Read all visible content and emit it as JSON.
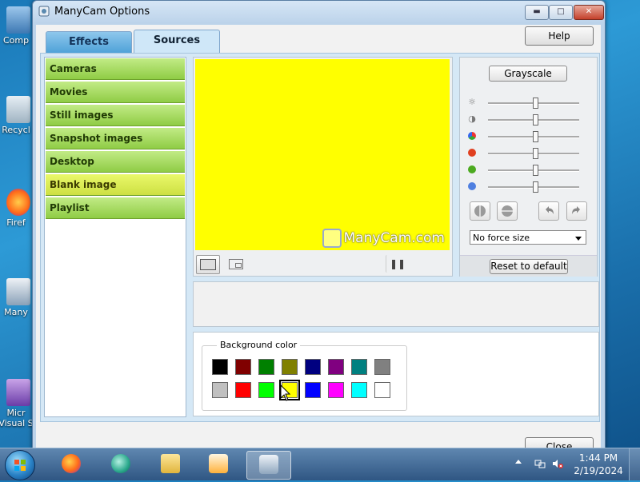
{
  "desktop": {
    "icons": [
      {
        "label": "Comp"
      },
      {
        "label": "Recycl"
      },
      {
        "label": "Firef"
      },
      {
        "label": "Many"
      },
      {
        "label": "Micr",
        "label2": "Visual S"
      }
    ]
  },
  "window": {
    "title": "ManyCam Options",
    "buttons": {
      "minimize": "▬",
      "maximize": "□",
      "close": "✕"
    }
  },
  "tabs": [
    {
      "label": "Effects"
    },
    {
      "label": "Sources",
      "active": true
    }
  ],
  "help_label": "Help",
  "sources": {
    "items": [
      {
        "label": "Cameras"
      },
      {
        "label": "Movies"
      },
      {
        "label": "Still images"
      },
      {
        "label": "Snapshot images"
      },
      {
        "label": "Desktop"
      },
      {
        "label": "Blank image",
        "active": true
      },
      {
        "label": "Playlist"
      }
    ]
  },
  "preview": {
    "background_color": "#FFFF00",
    "watermark": "ManyCam.com",
    "pause_glyph": "❚❚"
  },
  "adjust": {
    "grayscale_label": "Grayscale",
    "sliders": [
      {
        "name": "brightness",
        "icon": "sun-icon",
        "glyph": "☼",
        "color": "#888888",
        "value": 0.5
      },
      {
        "name": "contrast",
        "icon": "contrast-icon",
        "glyph": "◑",
        "color": "#888888",
        "value": 0.5
      },
      {
        "name": "saturation",
        "icon": "color-wheel-icon",
        "glyph": "●",
        "color": "#9a5fb0",
        "value": 0.5
      },
      {
        "name": "red",
        "icon": "red-dot-icon",
        "glyph": "●",
        "color": "#e04020",
        "value": 0.5
      },
      {
        "name": "green",
        "icon": "green-dot-icon",
        "glyph": "●",
        "color": "#4caa20",
        "value": 0.5
      },
      {
        "name": "blue",
        "icon": "blue-dot-icon",
        "glyph": "●",
        "color": "#4f7fe0",
        "value": 0.5
      }
    ],
    "force_size": "No force size",
    "reset_label": "Reset to default"
  },
  "background_color": {
    "title": "Background color",
    "colors_row1": [
      "#000000",
      "#800000",
      "#008000",
      "#808000",
      "#000080",
      "#800080",
      "#008080",
      "#808080"
    ],
    "colors_row2": [
      "#C0C0C0",
      "#FF0000",
      "#00FF00",
      "#FFFF00",
      "#0000FF",
      "#FF00FF",
      "#00FFFF",
      "#FFFFFF"
    ],
    "selected": "#FFFF00"
  },
  "close_label": "Close",
  "taskbar": {
    "time": "1:44 PM",
    "date": "2/19/2024"
  }
}
